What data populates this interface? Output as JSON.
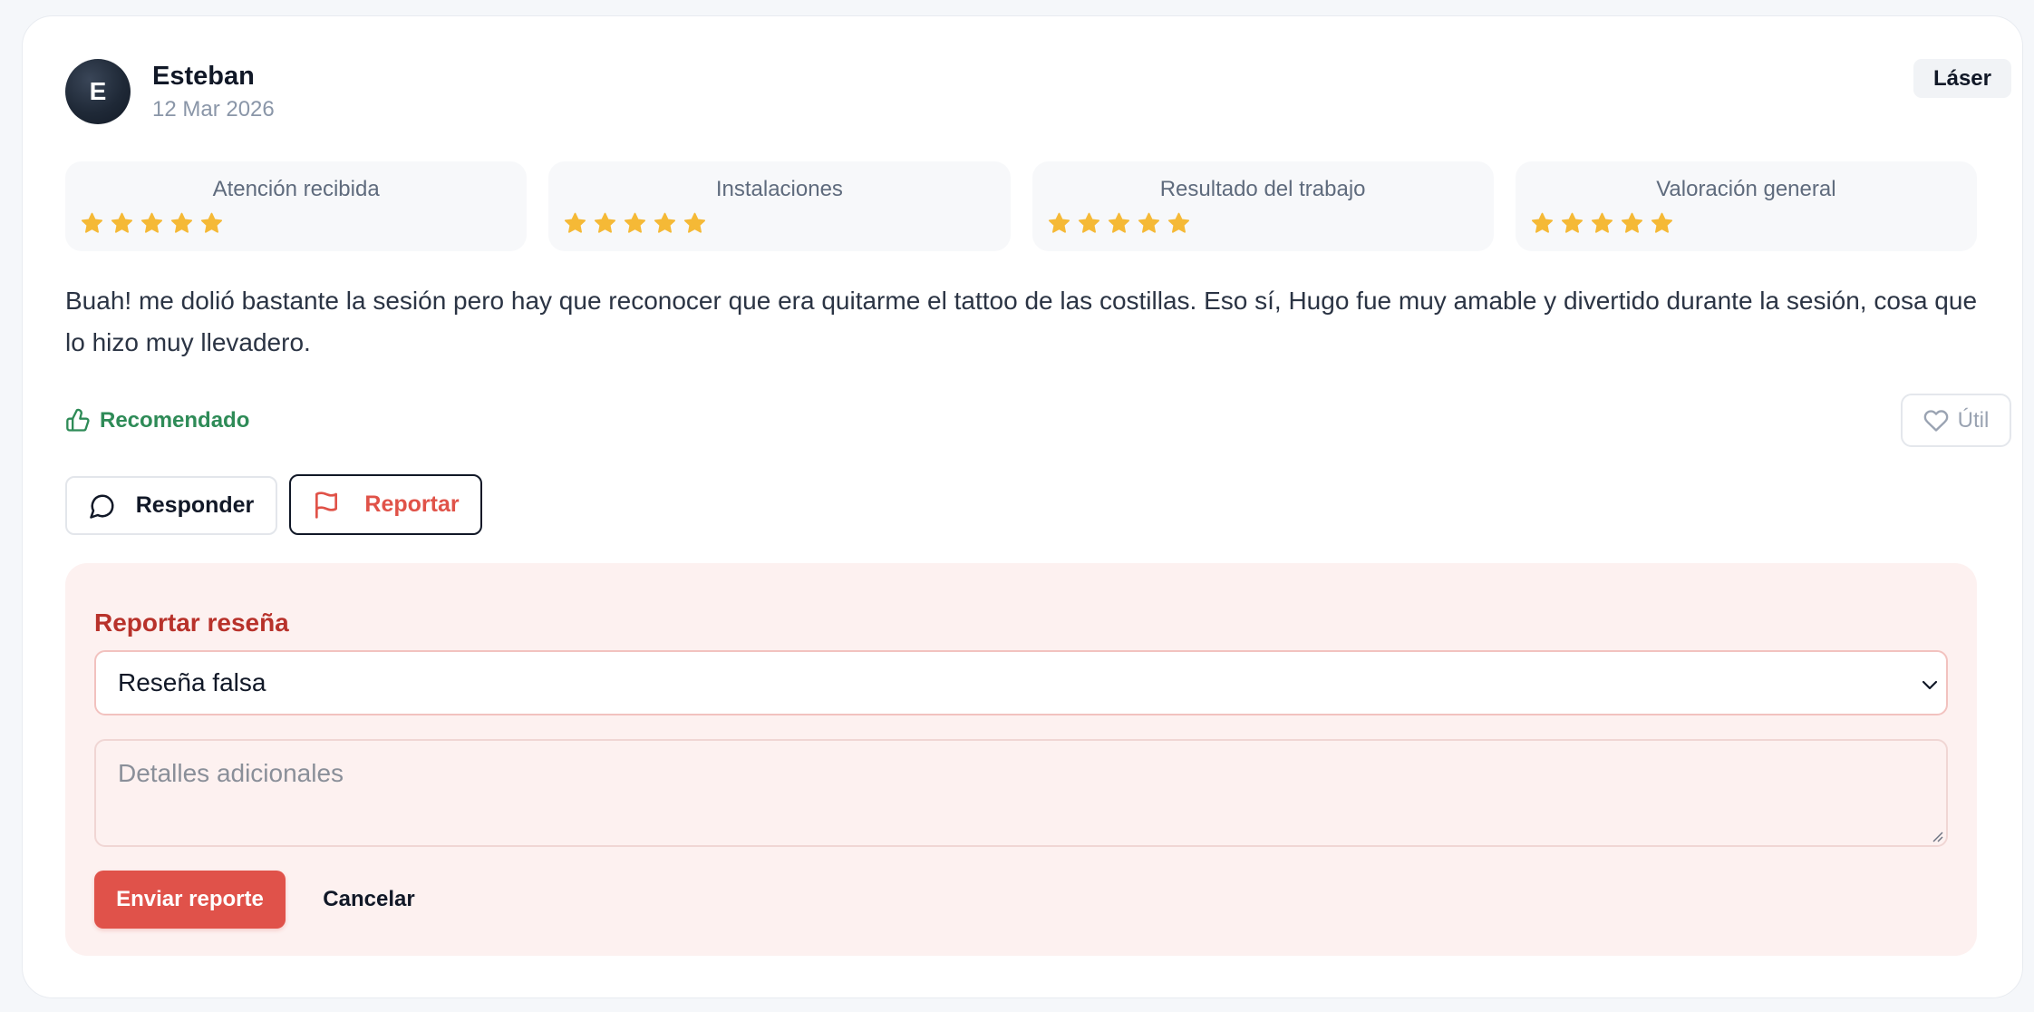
{
  "review": {
    "avatar_initial": "E",
    "author": "Esteban",
    "date": "12 Mar 2026",
    "tag": "Láser",
    "ratings": [
      {
        "label": "Atención recibida",
        "stars": 5
      },
      {
        "label": "Instalaciones",
        "stars": 5
      },
      {
        "label": "Resultado del trabajo",
        "stars": 5
      },
      {
        "label": "Valoración general",
        "stars": 5
      }
    ],
    "body": "Buah! me dolió bastante la sesión pero hay que reconocer que era quitarme el tattoo de las costillas. Eso sí, Hugo fue muy amable y divertido durante la sesión, cosa que lo hizo muy llevadero.",
    "recommended_label": "Recomendado",
    "helpful_label": "Útil"
  },
  "actions": {
    "reply_label": "Responder",
    "report_label": "Reportar"
  },
  "report_form": {
    "title": "Reportar reseña",
    "reason_selected": "Reseña falsa",
    "details_placeholder": "Detalles adicionales",
    "submit_label": "Enviar reporte",
    "cancel_label": "Cancelar"
  },
  "colors": {
    "star": "#f5b936",
    "recommended": "#2e8b57",
    "report_accent": "#e0524a",
    "report_title": "#b8322b",
    "panel_bg": "#fdf1f0"
  },
  "icons": {
    "recommended": "thumbs-up-icon",
    "helpful": "heart-icon",
    "reply": "chat-bubble-icon",
    "report": "flag-icon",
    "select": "chevron-down-icon"
  }
}
